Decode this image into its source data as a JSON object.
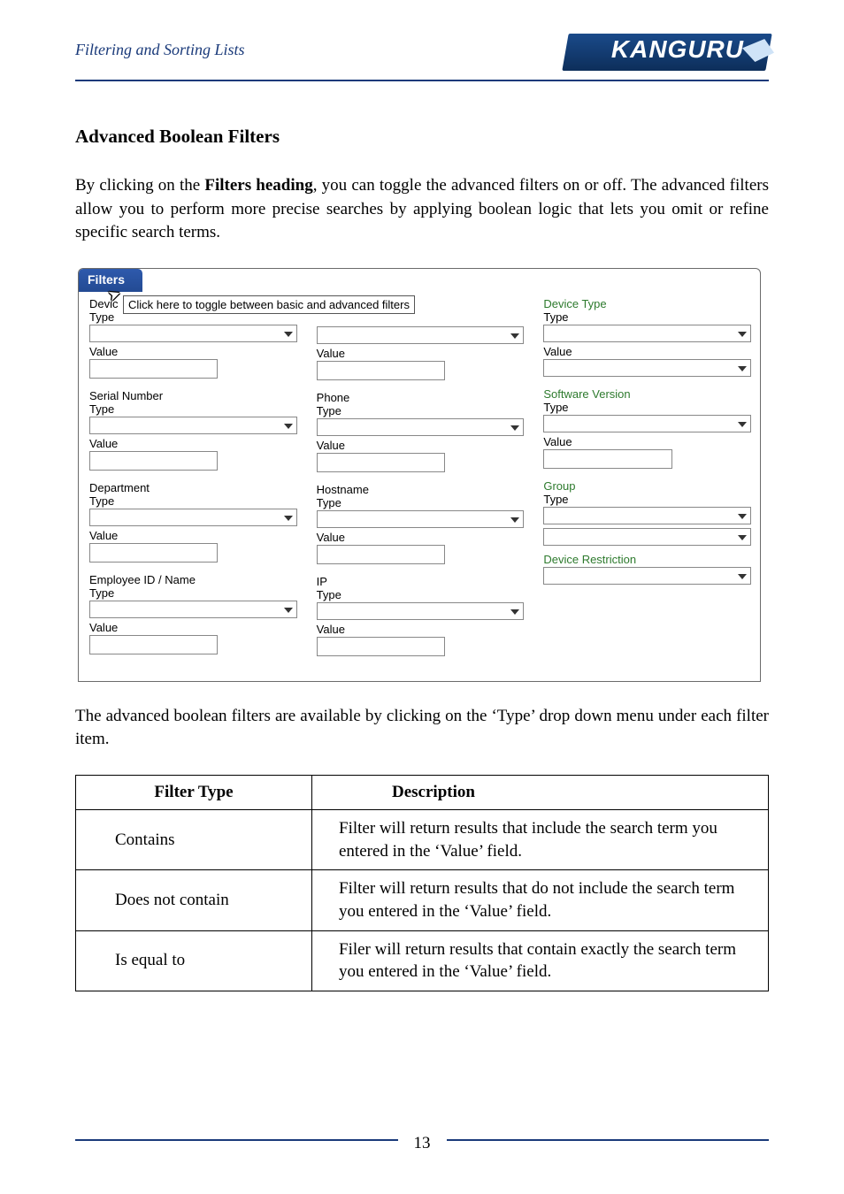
{
  "header": {
    "title": "Filtering and Sorting Lists",
    "logo_text": "KANGURU"
  },
  "section": {
    "heading": "Advanced Boolean Filters",
    "intro_pre": "By clicking on the ",
    "intro_bold": "Filters heading",
    "intro_post": ", you can toggle the advanced filters on or off. The advanced filters allow you to perform more precise searches by applying boolean logic that lets you omit or refine specific search terms.",
    "outro": "The advanced boolean filters are available by clicking on the ‘Type’ drop down menu under each filter item."
  },
  "ui": {
    "panel_title": "Filters",
    "tooltip": "Click here to toggle between basic and advanced filters",
    "labels": {
      "type": "Type",
      "value": "Value"
    },
    "col1": {
      "f1_trunc": "Devic",
      "f2": "Serial Number",
      "f3": "Department",
      "f4": "Employee ID / Name"
    },
    "col2": {
      "f2": "Phone",
      "f3": "Hostname",
      "f4": "IP"
    },
    "col3": {
      "f1": "Device Type",
      "f2": "Software Version",
      "f3": "Group",
      "f4": "Device Restriction"
    }
  },
  "table": {
    "h1": "Filter Type",
    "h2": "Description",
    "rows": [
      {
        "type": "Contains",
        "desc": "Filter will return results that include the search term you entered in the ‘Value’ field."
      },
      {
        "type": "Does not contain",
        "desc": "Filter will return results that do not include the search term you entered in the ‘Value’ field."
      },
      {
        "type": "Is equal to",
        "desc": "Filer will return results that contain exactly the search term you entered in the ‘Value’ field."
      }
    ]
  },
  "page_number": "13"
}
